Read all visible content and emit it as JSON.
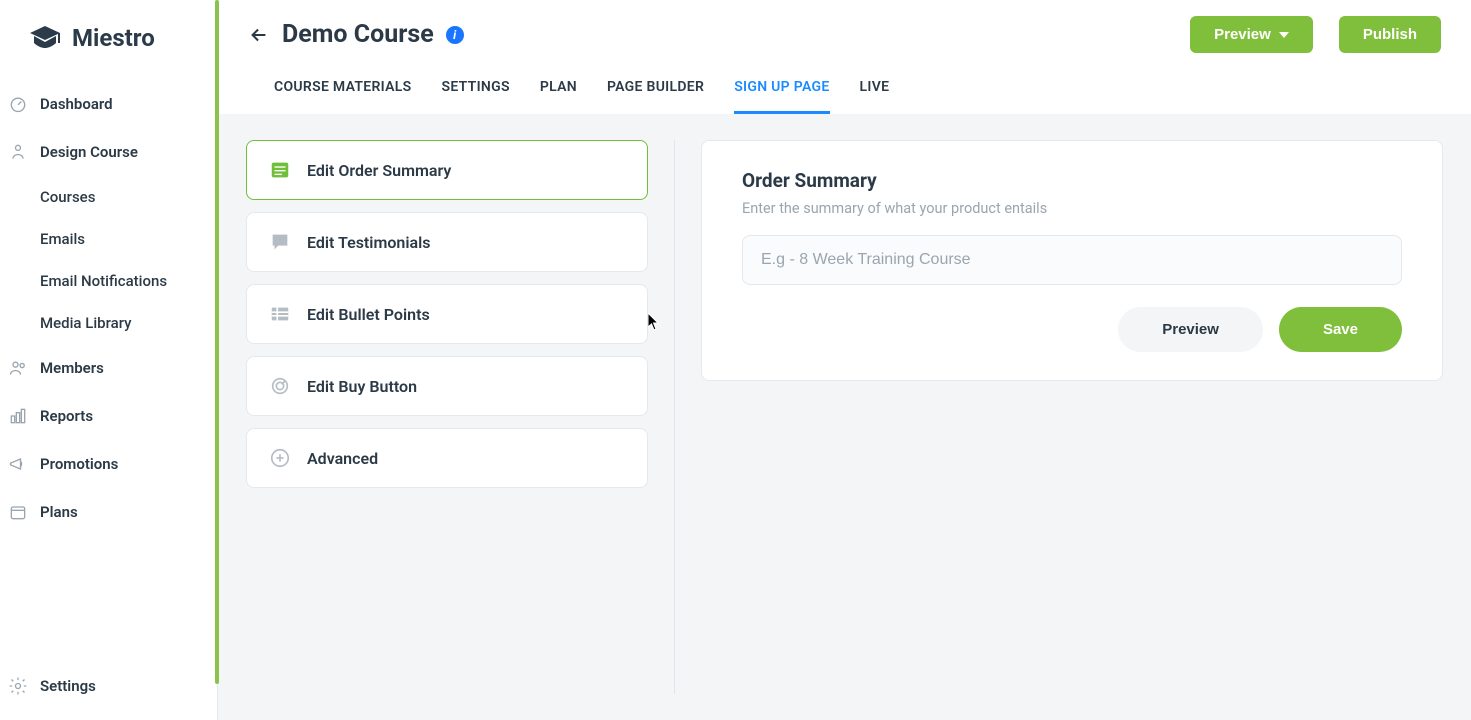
{
  "app": {
    "name": "Miestro"
  },
  "sidebar": {
    "items": [
      {
        "label": "Dashboard"
      },
      {
        "label": "Design Course"
      },
      {
        "label": "Members"
      },
      {
        "label": "Reports"
      },
      {
        "label": "Promotions"
      },
      {
        "label": "Plans"
      }
    ],
    "subitems": [
      {
        "label": "Courses"
      },
      {
        "label": "Emails"
      },
      {
        "label": "Email Notifications"
      },
      {
        "label": "Media Library"
      }
    ],
    "bottom": {
      "label": "Settings"
    }
  },
  "header": {
    "title": "Demo Course",
    "preview_label": "Preview",
    "publish_label": "Publish"
  },
  "tabs": [
    {
      "label": "COURSE MATERIALS"
    },
    {
      "label": "SETTINGS"
    },
    {
      "label": "PLAN"
    },
    {
      "label": "PAGE BUILDER"
    },
    {
      "label": "SIGN UP PAGE",
      "active": true
    },
    {
      "label": "LIVE"
    }
  ],
  "edit_list": [
    {
      "label": "Edit Order Summary",
      "active": true
    },
    {
      "label": "Edit Testimonials"
    },
    {
      "label": "Edit Bullet Points"
    },
    {
      "label": "Edit Buy Button"
    },
    {
      "label": "Advanced"
    }
  ],
  "panel": {
    "title": "Order Summary",
    "description": "Enter the summary of what your product entails",
    "input_value": "",
    "input_placeholder": "E.g - 8 Week Training Course",
    "preview_label": "Preview",
    "save_label": "Save"
  }
}
